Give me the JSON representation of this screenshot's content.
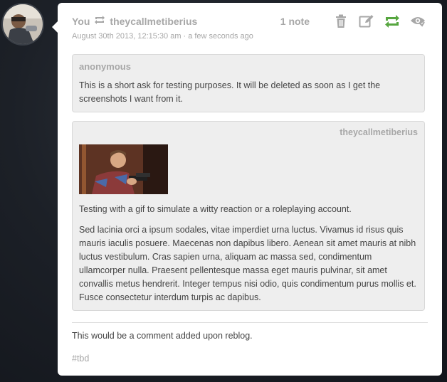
{
  "post": {
    "author": "You",
    "reblogged_from": "theycallmetiberius",
    "date": "August 30th 2013, 12:15:30 am",
    "relative_time": "a few seconds ago",
    "notes": "1 note",
    "ask": {
      "asker": "anonymous",
      "text": "This is a short ask for testing purposes. It will be deleted as soon as I get the screenshots I want from it."
    },
    "reblog": {
      "source": "theycallmetiberius",
      "caption": "Testing with a gif to simulate a witty reaction or a roleplaying account.",
      "body": "Sed lacinia orci a ipsum sodales, vitae imperdiet urna luctus. Vivamus id risus quis mauris iaculis posuere. Maecenas non dapibus libero. Aenean sit amet mauris at nibh luctus vestibulum. Cras sapien urna, aliquam ac massa sed, condimentum ullamcorper nulla. Praesent pellentesque massa eget mauris pulvinar, sit amet convallis metus hendrerit. Integer tempus nisi odio, quis condimentum purus mollis et. Fusce consectetur interdum turpis ac dapibus."
    },
    "comment": "This would be a comment added upon reblog.",
    "tag": "#tbd"
  },
  "icons": {
    "delete": "trash-icon",
    "edit": "edit-icon",
    "reblog": "reblog-icon",
    "queue": "queue-eye-icon"
  },
  "colors": {
    "reblog_active": "#56a63f",
    "muted_text": "#a7a7a7",
    "box_bg": "#eeeeee"
  }
}
